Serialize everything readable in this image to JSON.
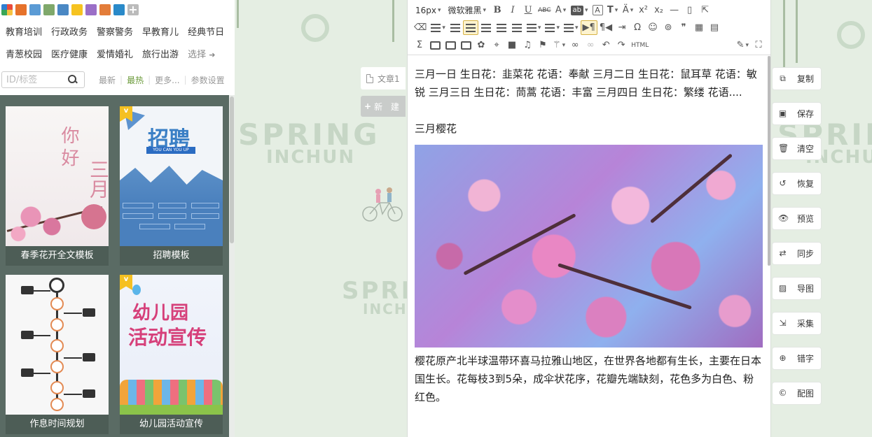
{
  "palette": {
    "colors": [
      "#e6722b",
      "#5b9bd5",
      "#7fa86b",
      "#4a88c4",
      "#f6c320",
      "#9b6fc7",
      "#e37d3a",
      "#2a8ac9"
    ]
  },
  "categories": {
    "row1": [
      "教育培训",
      "行政政务",
      "警察警务",
      "早教育儿",
      "经典节日"
    ],
    "row2": [
      "青葱校园",
      "医疗健康",
      "爱情婚礼",
      "旅行出游"
    ],
    "select_label": "选择"
  },
  "search": {
    "placeholder": "ID/标签"
  },
  "sort": {
    "latest": "最新",
    "hot": "最热",
    "more": "更多...",
    "settings": "参数设置"
  },
  "templates": [
    {
      "caption": "春季花开全文模板",
      "vip": false
    },
    {
      "caption": "招聘模板",
      "vip": true
    },
    {
      "caption": "作息时间规划",
      "vip": false
    },
    {
      "caption": "幼儿园活动宣传",
      "vip": true
    }
  ],
  "thumb_text": {
    "t1_a": "你好",
    "t1_b": "三月",
    "t2_title": "招聘",
    "t2_sub": "YOU CAN YOU UP",
    "t4_a": "幼儿园",
    "t4_b": "活动宣传"
  },
  "background": {
    "spring": "SPRING",
    "inchun": "INCHUN"
  },
  "articles": {
    "tab_label": "文章1",
    "new_label": "新 建"
  },
  "toolbar": {
    "font_size": "16px",
    "font_family": "微软雅黑",
    "html_label": "HTML",
    "omega": "Ω",
    "quote": "❞"
  },
  "content": {
    "para1": "三月一日 生日花：韭菜花 花语：奉献 三月二日 生日花：鼠耳草 花语：敏锐 三月三日 生日花：茼蒿 花语：丰富 三月四日 生日花：繁缕 花语....",
    "heading": "三月樱花",
    "para2": "樱花原产北半球温带环喜马拉雅山地区，在世界各地都有生长，主要在日本国生长。花每枝3到5朵，成伞状花序，花瓣先端缺刻，花色多为白色、粉红色。"
  },
  "actions": [
    "复制",
    "保存",
    "清空",
    "恢复",
    "预览",
    "同步",
    "导图",
    "采集",
    "错字",
    "配图"
  ]
}
